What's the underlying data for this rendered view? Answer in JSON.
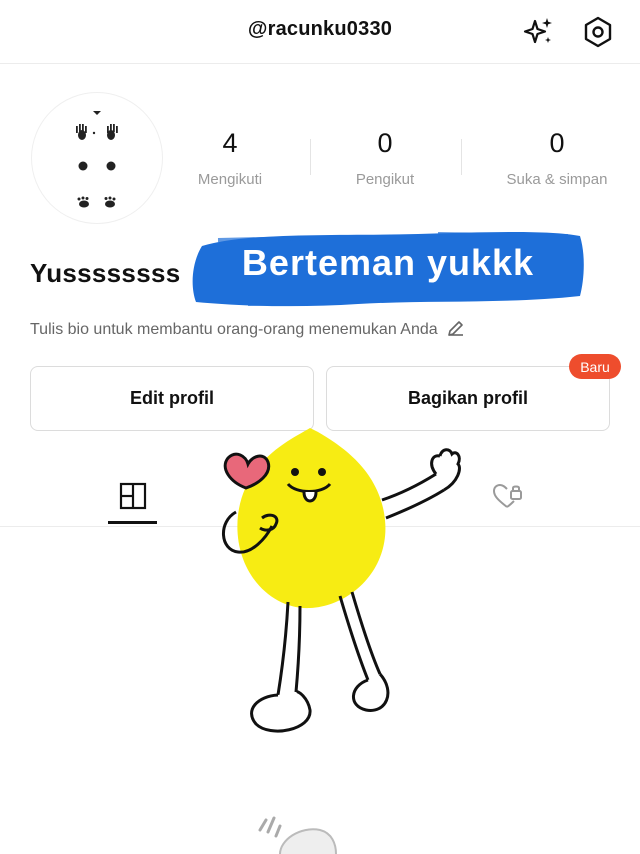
{
  "header": {
    "username": "@racunku0330",
    "sparkle_icon": "sparkle-icon",
    "settings_icon": "settings-hex-icon"
  },
  "profile": {
    "display_name": "Yussssssss",
    "sticker_text": "Berteman yukkk",
    "bio_placeholder": "Tulis bio untuk membantu orang-orang menemukan Anda",
    "stats": [
      {
        "value": "4",
        "label": "Mengikuti"
      },
      {
        "value": "0",
        "label": "Pengikut"
      },
      {
        "value": "0",
        "label": "Suka & simpan"
      }
    ]
  },
  "actions": {
    "edit_label": "Edit profil",
    "share_label": "Bagikan profil",
    "share_badge": "Baru"
  },
  "tabs": {
    "active": "grid",
    "items": [
      "grid-icon",
      "heart-lock-icon"
    ]
  },
  "colors": {
    "accent": "#ee4d2d",
    "sticker_blue": "#1e6fd9",
    "mascot_yellow": "#f7ec13"
  }
}
